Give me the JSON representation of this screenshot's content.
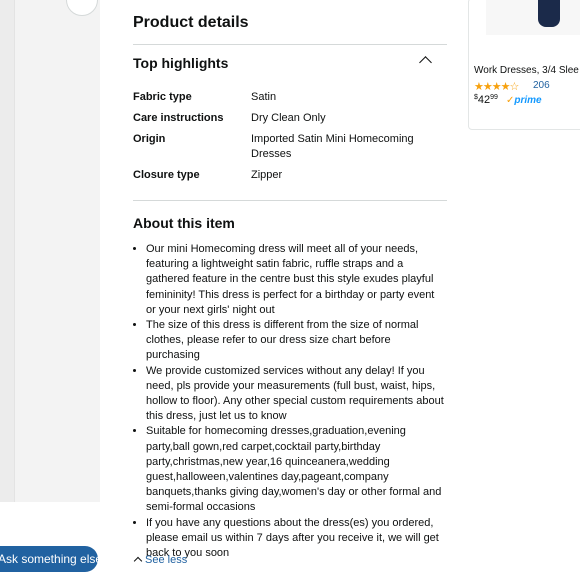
{
  "assistant": {
    "button_label": "Ask something else"
  },
  "product_details": {
    "heading": "Product details",
    "top_highlights": {
      "heading": "Top highlights",
      "rows": [
        {
          "label": "Fabric type",
          "value": "Satin"
        },
        {
          "label": "Care instructions",
          "value": "Dry Clean Only"
        },
        {
          "label": "Origin",
          "value": "Imported Satin Mini Homecoming Dresses"
        },
        {
          "label": "Closure type",
          "value": "Zipper"
        }
      ]
    },
    "about": {
      "heading": "About this item",
      "bullets": [
        "Our mini Homecoming dress will meet all of your needs, featuring a lightweight satin fabric, ruffle straps and a gathered feature in the centre bust this style exudes playful femininity! This dress is perfect for a birthday or party event or your next girls' night out",
        "The size of this dress is different from the size of normal clothes, please refer to our dress size chart before purchasing",
        "We provide customized services without any delay! If you need, pls provide your measurements (full bust, waist, hips, hollow to floor). Any other special custom requirements about this dress, just let us to know",
        "Suitable for homecoming dresses,graduation,evening party,ball gown,red carpet,cocktail party,birthday party,christmas,new year,16 quinceanera,wedding guest,halloween,valentines day,pageant,company banquets,thanks giving day,women's day or other formal and semi-formal occasions",
        "If you have any questions about the dress(es) you ordered, please email us within 7 days after you receive it, we will get back to you soon"
      ],
      "see_less_label": "See less"
    }
  },
  "sponsored_card": {
    "title": "Work Dresses, 3/4 Slee",
    "stars": "★★★★☆",
    "rating_count": "206",
    "price_currency": "$",
    "price_whole": "42",
    "price_fraction": "99",
    "prime_label": "prime"
  },
  "colors": {
    "link": "#2162a1",
    "star": "#f7a10e",
    "prime": "#1399ff",
    "divider": "#d5d9d9"
  }
}
